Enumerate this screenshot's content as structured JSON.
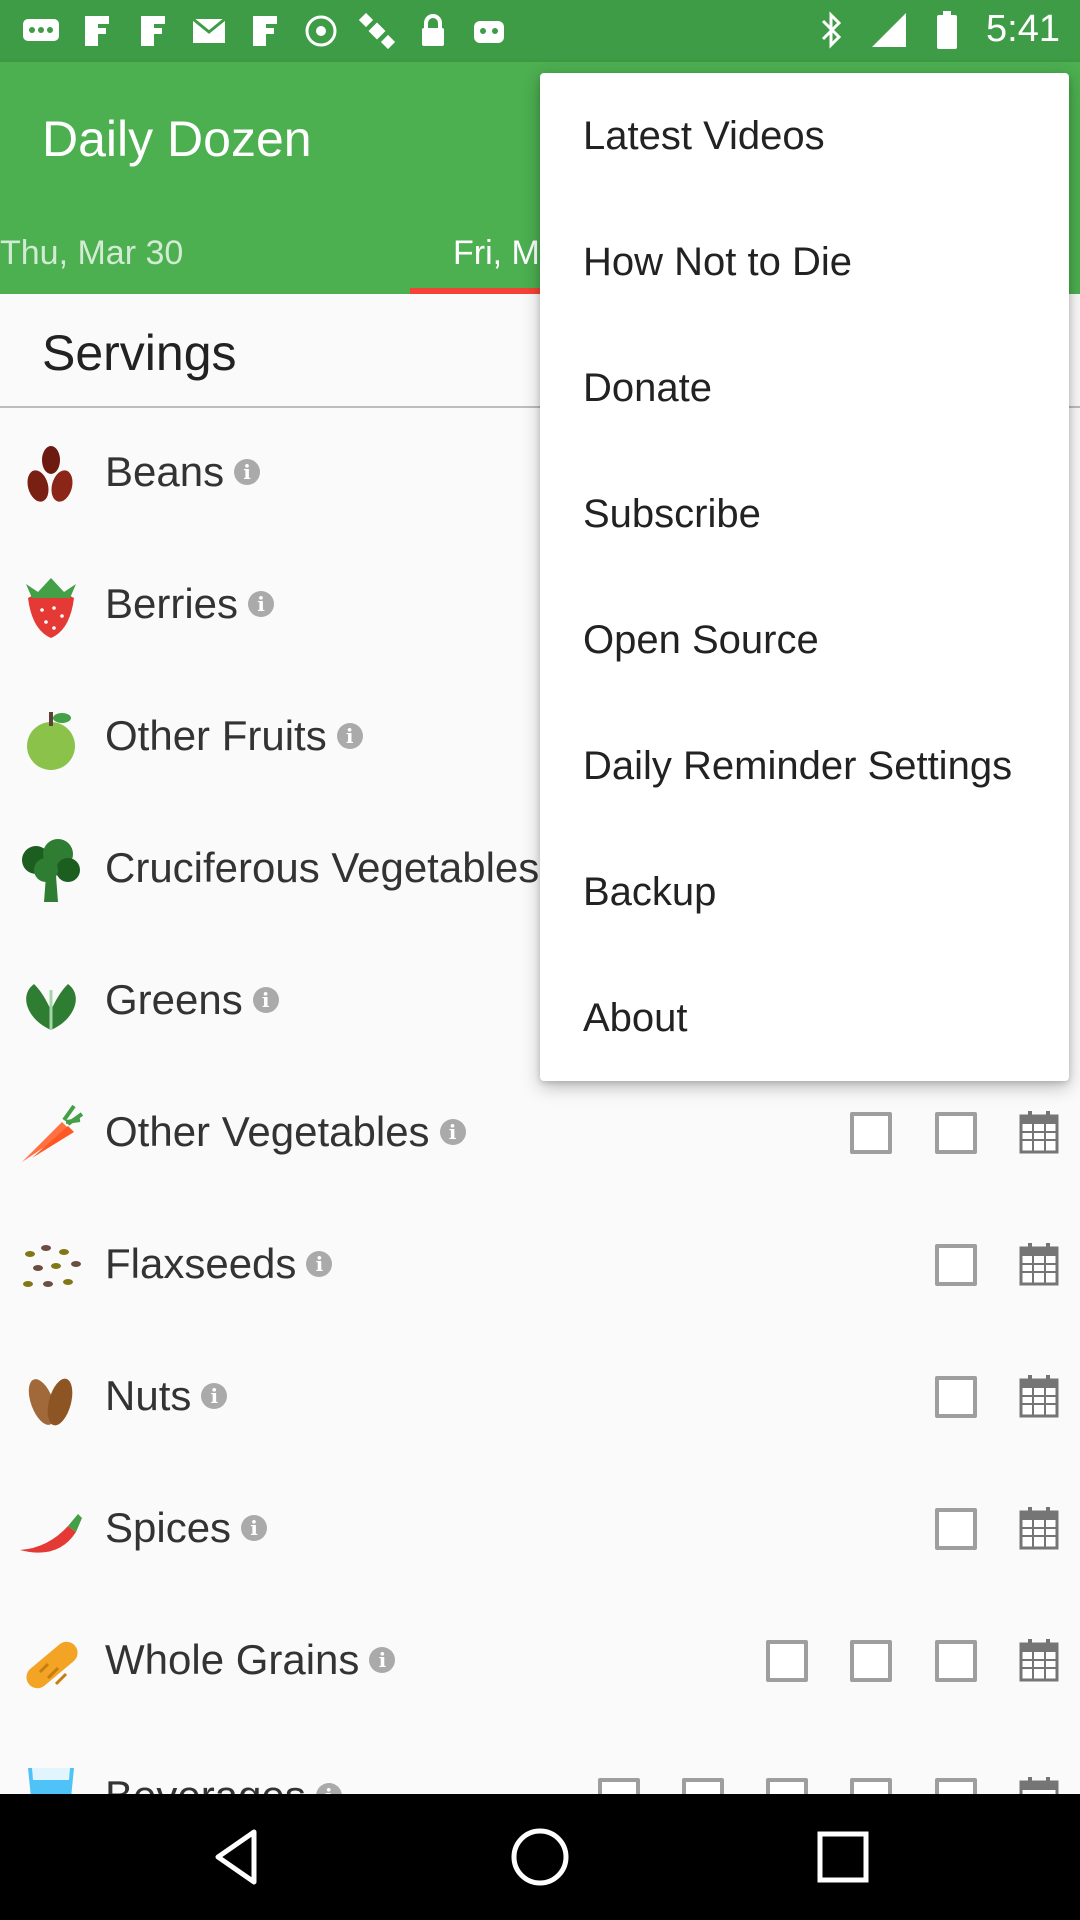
{
  "status_bar": {
    "time": "5:41"
  },
  "app": {
    "title": "Daily Dozen"
  },
  "tabs": [
    {
      "label": "Thu, Mar 30"
    },
    {
      "label": "Fri, M"
    }
  ],
  "servings": {
    "title": "Servings"
  },
  "foods": [
    {
      "label": "Beans",
      "icon": "beans-icon"
    },
    {
      "label": "Berries",
      "icon": "strawberry-icon"
    },
    {
      "label": "Other Fruits",
      "icon": "apple-icon"
    },
    {
      "label": "Cruciferous Vegetables",
      "icon": "broccoli-icon"
    },
    {
      "label": "Greens",
      "icon": "greens-icon"
    },
    {
      "label": "Other Vegetables",
      "icon": "carrot-icon"
    },
    {
      "label": "Flaxseeds",
      "icon": "flaxseeds-icon"
    },
    {
      "label": "Nuts",
      "icon": "nuts-icon"
    },
    {
      "label": "Spices",
      "icon": "chili-icon"
    },
    {
      "label": "Whole Grains",
      "icon": "bread-icon"
    },
    {
      "label": "Beverages",
      "icon": "glass-icon"
    }
  ],
  "menu": {
    "items": [
      {
        "label": "Latest Videos"
      },
      {
        "label": "How Not to Die"
      },
      {
        "label": "Donate"
      },
      {
        "label": "Subscribe"
      },
      {
        "label": "Open Source"
      },
      {
        "label": "Daily Reminder Settings"
      },
      {
        "label": "Backup"
      },
      {
        "label": "About"
      }
    ]
  },
  "colors": {
    "status_bar": "#3e9b46",
    "app_bar": "#4caf50",
    "tab_indicator": "#f44336"
  }
}
